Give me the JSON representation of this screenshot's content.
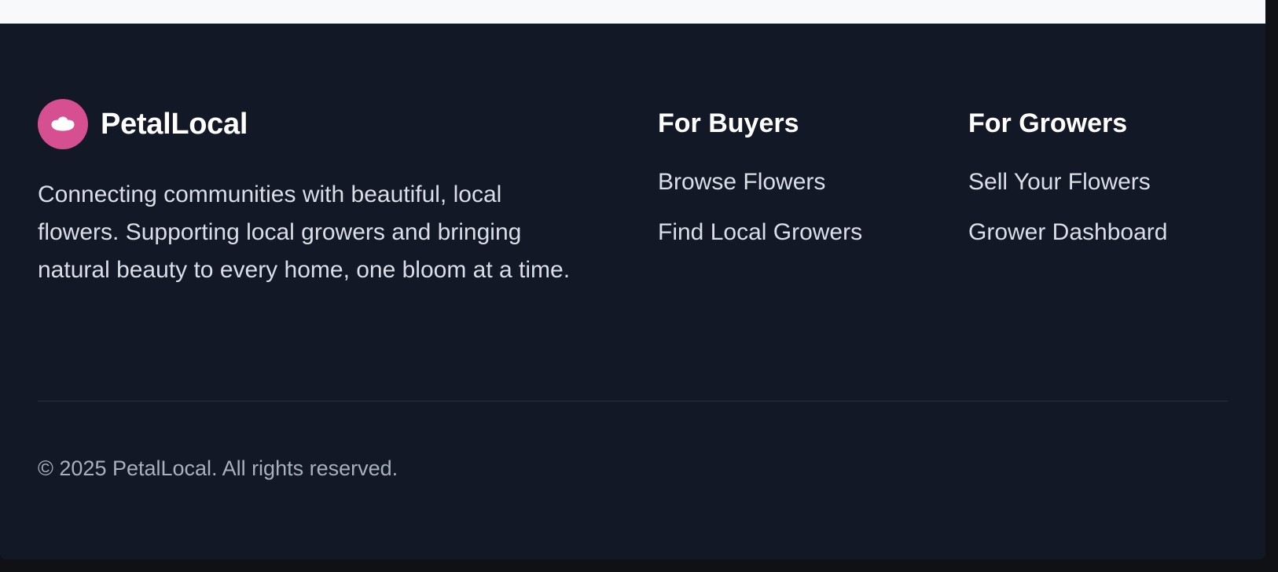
{
  "brand": {
    "name": "PetalLocal",
    "logo_icon": "flower-bloom-icon",
    "accent_color": "#d64f90"
  },
  "tagline": "Connecting communities with beautiful, local flowers. Supporting local growers and bringing natural beauty to every home, one bloom at a time.",
  "columns": [
    {
      "title": "For Buyers",
      "links": [
        "Browse Flowers",
        "Find Local Growers"
      ]
    },
    {
      "title": "For Growers",
      "links": [
        "Sell Your Flowers",
        "Grower Dashboard"
      ]
    }
  ],
  "copyright": "© 2025 PetalLocal. All rights reserved.",
  "colors": {
    "footer_background": "#131826",
    "top_strip_background": "#f8f9fb",
    "text_primary": "#ffffff",
    "text_secondary": "#d9dee8",
    "text_muted": "#a8b0be"
  }
}
